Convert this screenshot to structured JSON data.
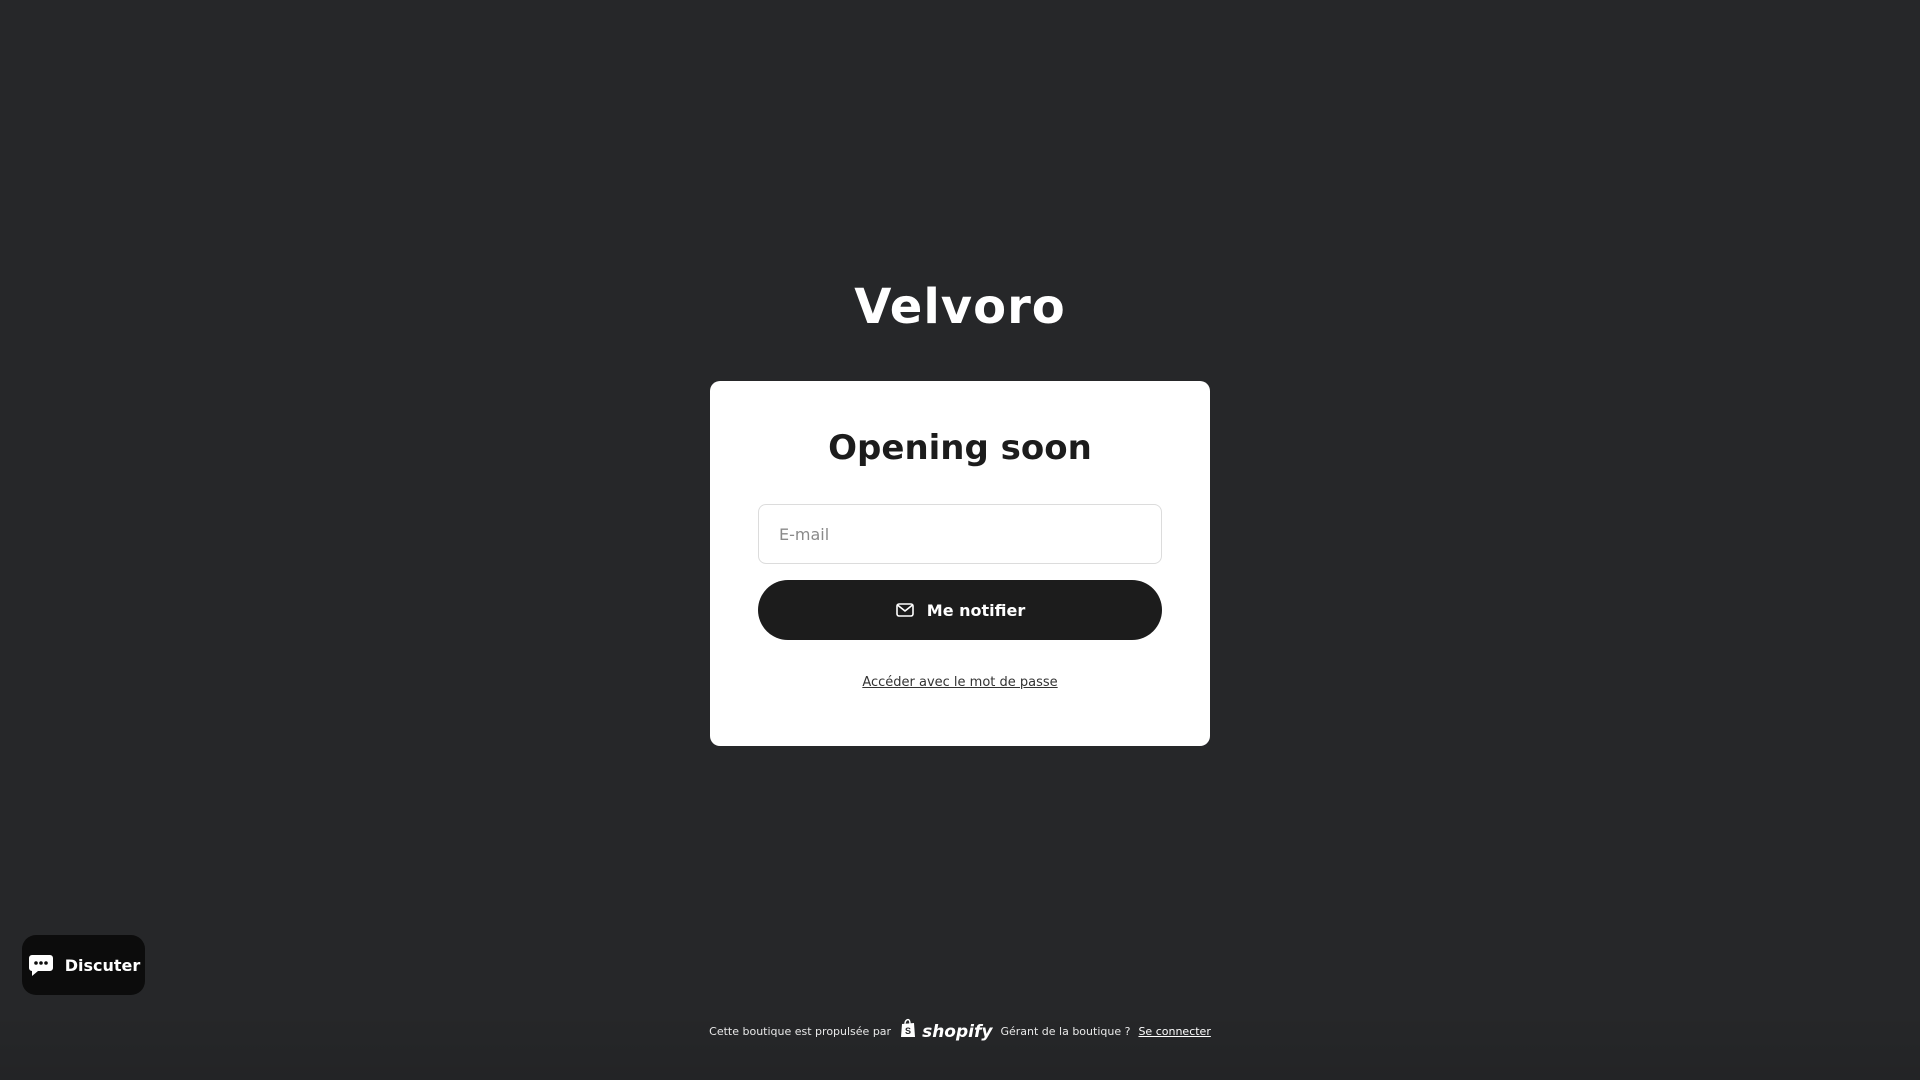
{
  "store": {
    "name": "Velvoro"
  },
  "card": {
    "heading": "Opening soon",
    "email_placeholder": "E-mail",
    "email_value": "",
    "notify_label": "Me notifier",
    "password_link": "Accéder avec le mot de passe"
  },
  "chat": {
    "label": "Discuter",
    "icon": "chat-bubble-icon"
  },
  "footer": {
    "powered_by": "Cette boutique est propulsée par",
    "brand": "shopify",
    "owner_question": "Gérant de la boutique ?",
    "login_link": "Se connecter"
  },
  "colors": {
    "background": "#262729",
    "card": "#ffffff",
    "button": "#1c1c1c",
    "chat_button": "#0c0c0c"
  }
}
